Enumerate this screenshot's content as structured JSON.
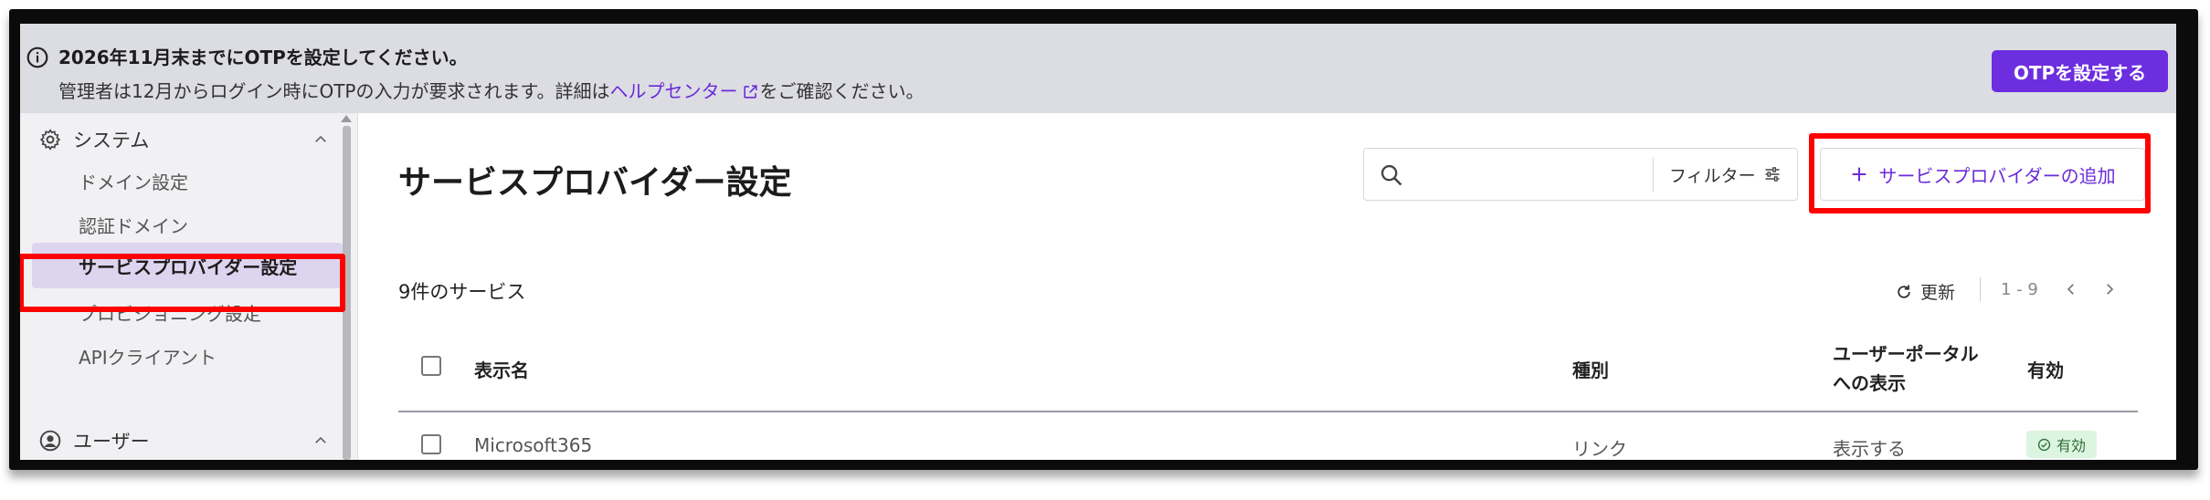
{
  "banner": {
    "title": "2026年11月末までにOTPを設定してください。",
    "desc_before": "管理者は12月からログイン時にOTPの入力が要求されます。詳細は",
    "link": "ヘルプセンター",
    "desc_after": "をご確認ください。",
    "button_label": "OTPを設定する"
  },
  "sidebar": {
    "system_label": "システム",
    "items": [
      {
        "label": "ドメイン設定"
      },
      {
        "label": "認証ドメイン"
      },
      {
        "label": "サービスプロバイダー設定",
        "active": true
      },
      {
        "label": "プロビジョニング設定"
      },
      {
        "label": "APIクライアント"
      }
    ],
    "user_label": "ユーザー"
  },
  "main": {
    "title": "サービスプロバイダー設定",
    "search_placeholder": "",
    "filter_label": "フィルター",
    "add_button_label": "サービスプロバイダーの追加",
    "count_label": "9件のサービス",
    "refresh_label": "更新",
    "page_range": "1 - 9"
  },
  "table": {
    "headers": {
      "name": "表示名",
      "type": "種別",
      "portal_line1": "ユーザーポータル",
      "portal_line2": "への表示",
      "enabled": "有効"
    },
    "rows": [
      {
        "name": "Microsoft365",
        "type": "リンク",
        "portal": "表示する",
        "status": "有効"
      }
    ]
  },
  "colors": {
    "accent": "#6c2edf",
    "highlight": "#ff0000",
    "badge_bg": "#dcf5e0"
  }
}
